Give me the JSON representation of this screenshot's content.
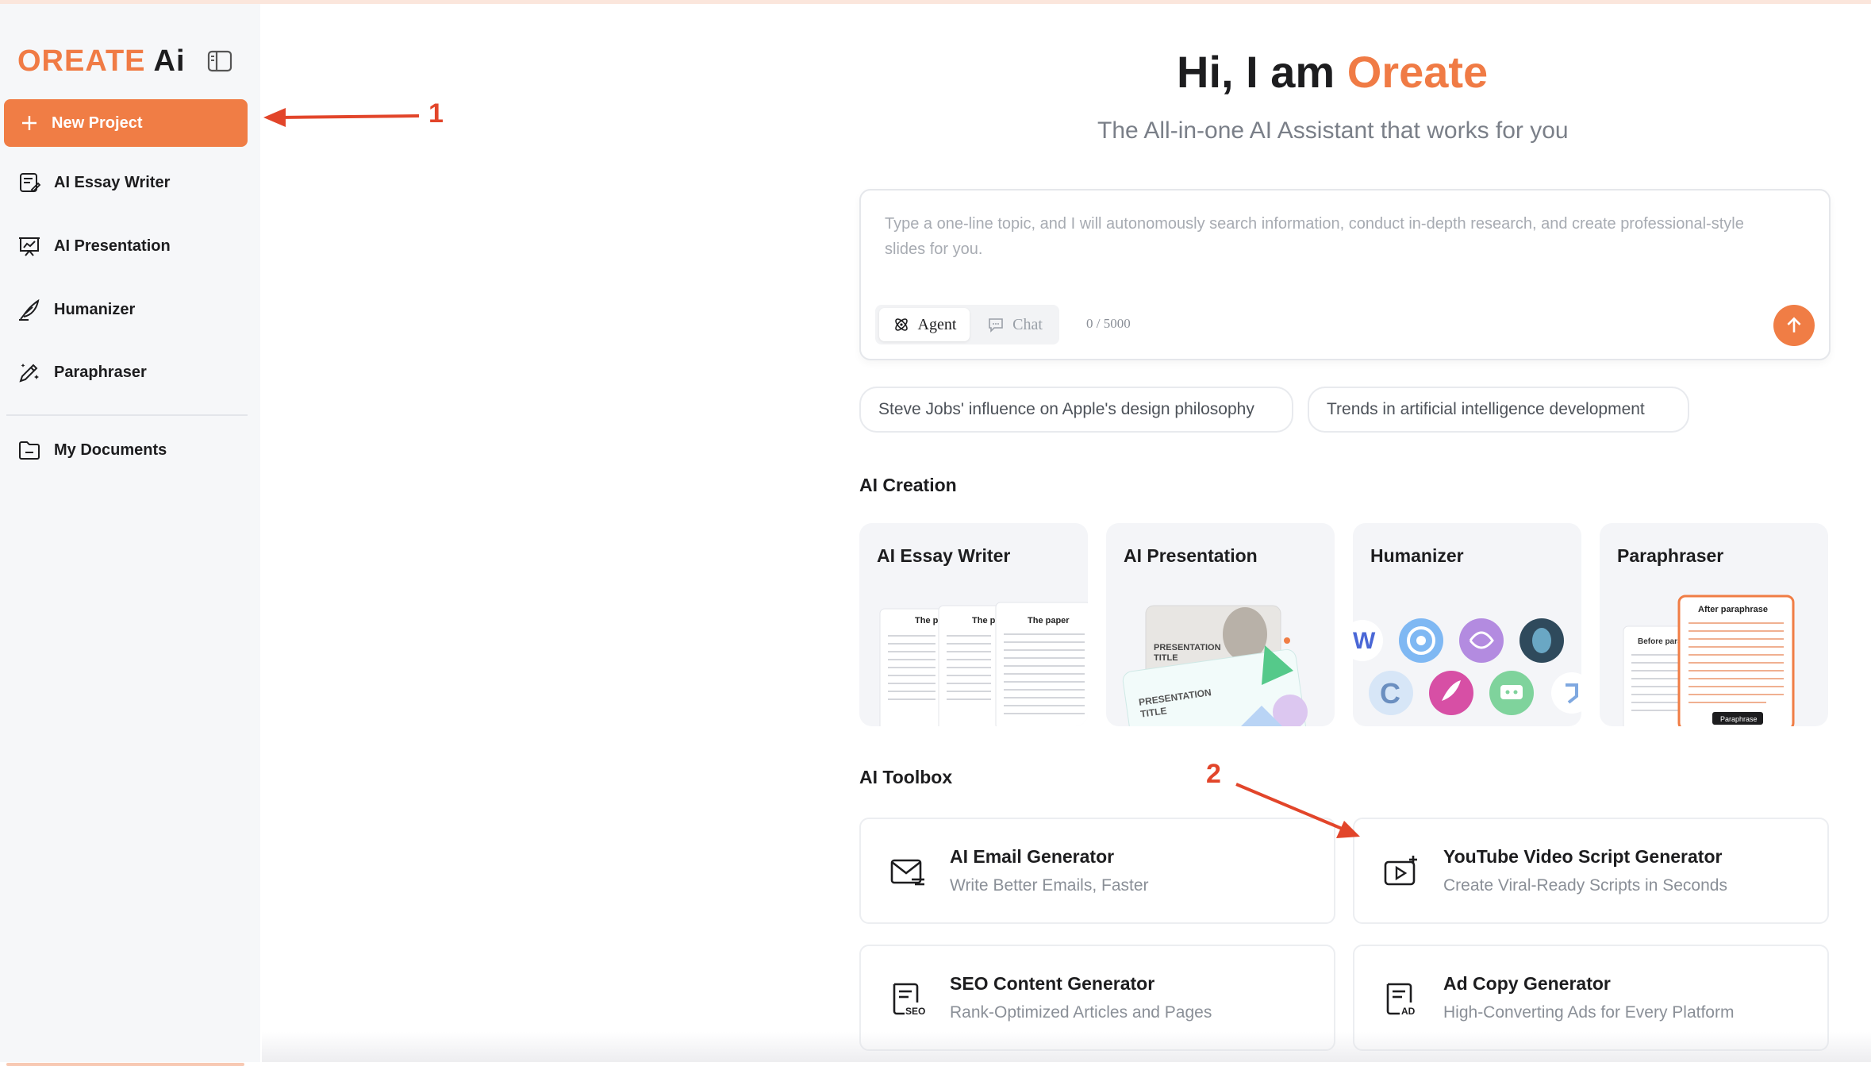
{
  "app": {
    "logo_brand": "OREATE",
    "logo_ai": "Ai"
  },
  "sidebar": {
    "new_project": "New Project",
    "items": [
      {
        "label": "AI Essay Writer",
        "icon": "essay-icon"
      },
      {
        "label": "AI Presentation",
        "icon": "presentation-icon"
      },
      {
        "label": "Humanizer",
        "icon": "feather-icon"
      },
      {
        "label": "Paraphraser",
        "icon": "magic-pen-icon"
      }
    ],
    "documents": {
      "label": "My Documents",
      "icon": "folder-icon"
    }
  },
  "hero": {
    "title_prefix": "Hi, I am ",
    "title_brand": "Oreate",
    "subtitle": "The All-in-one AI Assistant that works for you"
  },
  "prompt": {
    "placeholder": "Type a one-line topic, and I will autonomously search information, conduct in-depth research, and create professional-style slides for you.",
    "mode_agent": "Agent",
    "mode_chat": "Chat",
    "selected_mode": "Agent",
    "counter": "0 / 5000"
  },
  "suggestions": [
    "Steve Jobs' influence on Apple's design philosophy",
    "Trends in artificial intelligence development"
  ],
  "ai_creation": {
    "title": "AI Creation",
    "cards": [
      {
        "title": "AI Essay Writer",
        "doc_titles": [
          "The p",
          "The p",
          "The paper"
        ]
      },
      {
        "title": "AI Presentation",
        "slide_title": "PRESENTATION\nTITLE"
      },
      {
        "title": "Humanizer"
      },
      {
        "title": "Paraphraser",
        "before_label": "Before paraph",
        "after_label": "After paraphrase",
        "button_label": "Paraphrase"
      }
    ]
  },
  "ai_toolbox": {
    "title": "AI Toolbox",
    "tools": [
      {
        "title": "AI Email Generator",
        "desc": "Write Better Emails, Faster",
        "icon": "email-icon"
      },
      {
        "title": "YouTube Video Script Generator",
        "desc": "Create Viral-Ready Scripts in Seconds",
        "icon": "video-script-icon"
      },
      {
        "title": "SEO Content Generator",
        "desc": "Rank-Optimized Articles and Pages",
        "icon": "seo-doc-icon",
        "icon_text": "SEO"
      },
      {
        "title": "Ad Copy Generator",
        "desc": "High-Converting Ads for Every Platform",
        "icon": "ad-doc-icon",
        "icon_text": "AD"
      }
    ]
  },
  "annotations": [
    "1",
    "2"
  ],
  "colors": {
    "accent": "#f07d45",
    "sidebar_bg": "#f6f7f9",
    "annotation": "#e2452a"
  }
}
